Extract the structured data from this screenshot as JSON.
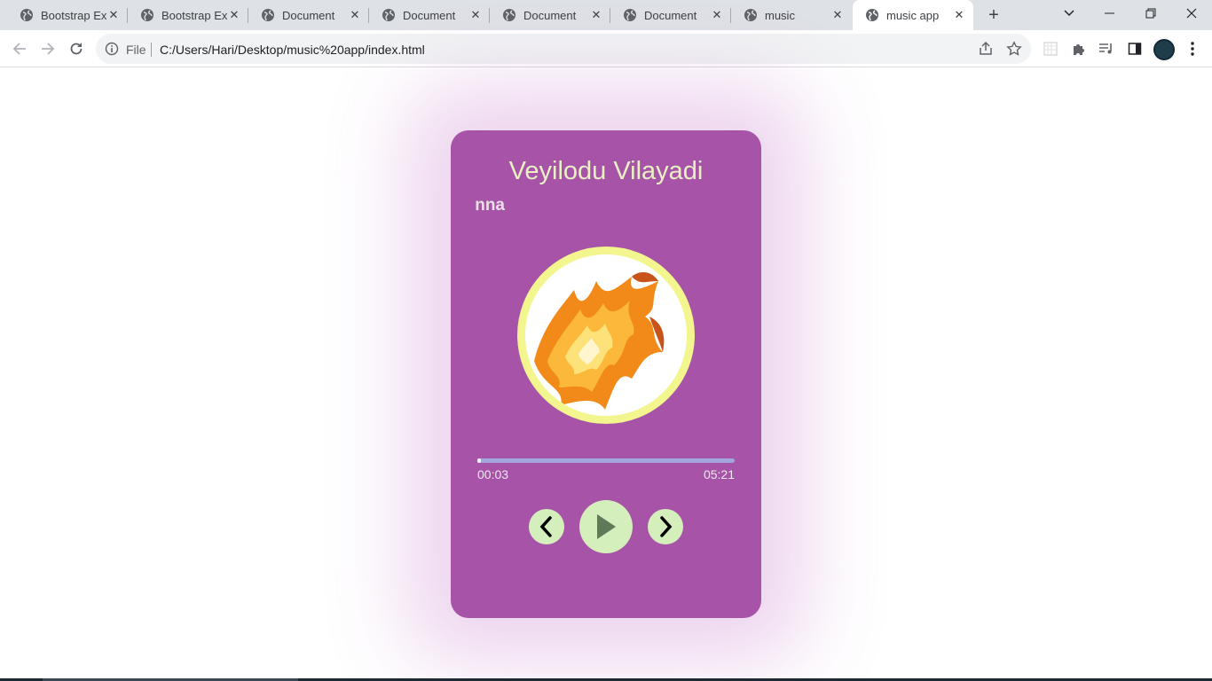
{
  "browser": {
    "tabs": [
      {
        "title": "Bootstrap Exa",
        "active": false
      },
      {
        "title": "Bootstrap Exa",
        "active": false
      },
      {
        "title": "Document",
        "active": false
      },
      {
        "title": "Document",
        "active": false
      },
      {
        "title": "Document",
        "active": false
      },
      {
        "title": "Document",
        "active": false
      },
      {
        "title": "music",
        "active": false
      },
      {
        "title": "music app",
        "active": true
      }
    ],
    "new_tab_label": "+",
    "address": {
      "scheme_label": "File",
      "url": "C:/Users/Hari/Desktop/music%20app/index.html"
    }
  },
  "player": {
    "song_title": "Veyilodu Vilayadi",
    "artist_visible": "nna",
    "current_time": "00:03",
    "duration": "05:21",
    "progress_fraction": 0.0094,
    "colors": {
      "card": "#a653a8",
      "title_text": "#e8f0c4",
      "disc_border": "#f3f58e",
      "progress_track": "#a3a6dc",
      "button": "#d5efbc"
    },
    "controls": {
      "prev_icon": "chevron-left-icon",
      "play_icon": "play-icon",
      "next_icon": "chevron-right-icon"
    }
  }
}
